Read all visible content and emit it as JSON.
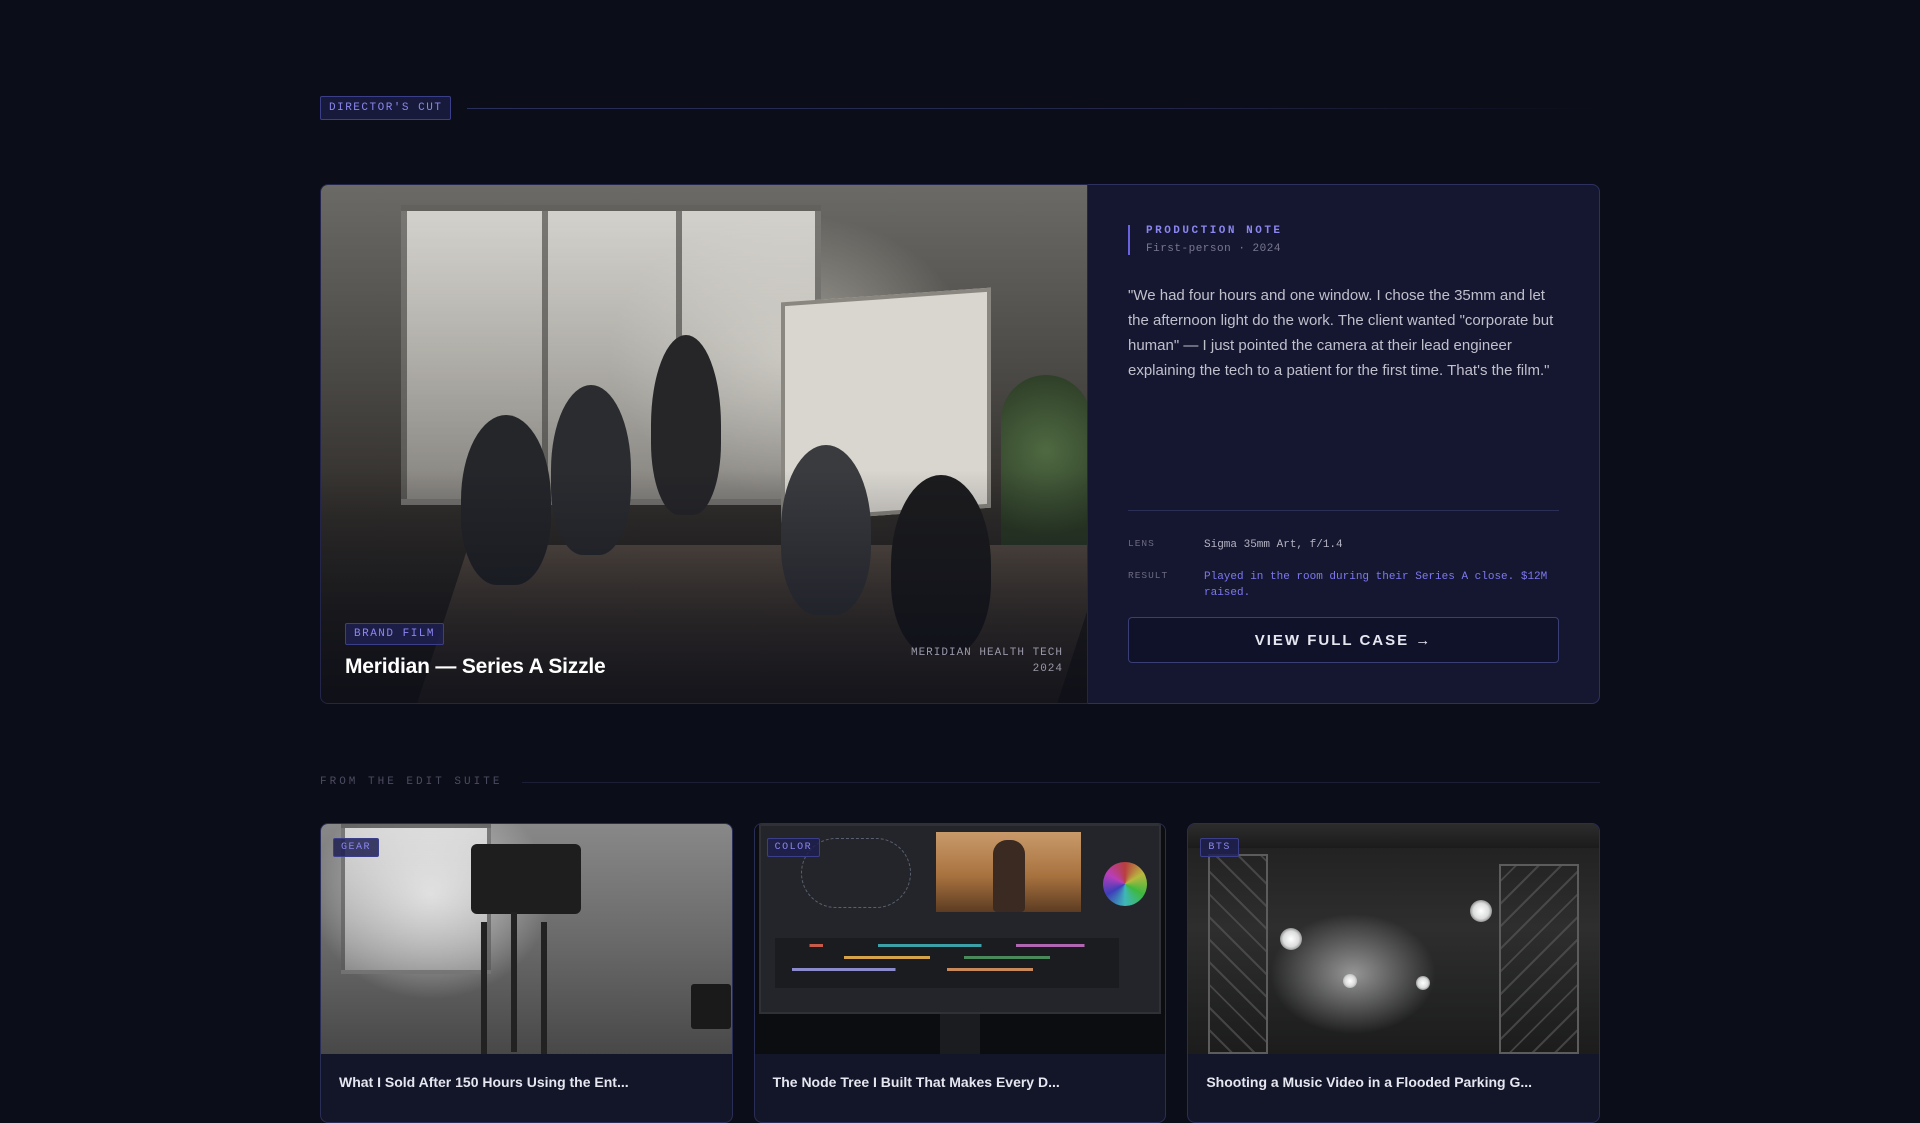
{
  "section": {
    "badge": "DIRECTOR'S CUT"
  },
  "featured": {
    "tag": "BRAND FILM",
    "title": "Meridian — Series A Sizzle",
    "client": "MERIDIAN HEALTH TECH",
    "year": "2024"
  },
  "note": {
    "label": "PRODUCTION NOTE",
    "subtitle": "First-person · 2024",
    "quote": "\"We had four hours and one window. I chose the 35mm and let the afternoon light do the work. The client wanted \"corporate but human\" — I just pointed the camera at their lead engineer explaining the tech to a patient for the first time. That's the film.\"",
    "specs": [
      {
        "key": "LENS",
        "value": "Sigma 35mm Art, f/1.4"
      },
      {
        "key": "RESULT",
        "value": "Played in the room during their Series A close. $12M raised."
      }
    ],
    "button_label": "VIEW FULL CASE →"
  },
  "suite": {
    "label": "FROM THE EDIT SUITE",
    "cards": [
      {
        "tag": "GEAR",
        "title": "What I Sold After 150 Hours Using the Ent..."
      },
      {
        "tag": "COLOR",
        "title": "The Node Tree I Built That Makes Every D..."
      },
      {
        "tag": "BTS",
        "title": "Shooting a Music Video in a Flooded Parking G..."
      }
    ]
  },
  "colors": {
    "background": "#0b0d18",
    "panel": "#151730",
    "accent": "#7d78ee",
    "border": "#2e3160"
  }
}
